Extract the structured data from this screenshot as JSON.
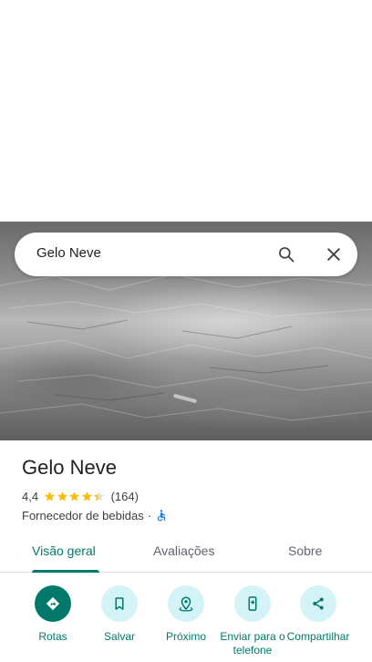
{
  "search": {
    "query": "Gelo Neve"
  },
  "place": {
    "title": "Gelo Neve",
    "rating": "4,4",
    "review_count": "(164)",
    "category": "Fornecedor de bebidas",
    "separator": "·",
    "stars_value": 4.4,
    "stars_max": 5,
    "star_color": "#fbbc04"
  },
  "tabs": [
    {
      "label": "Visão geral",
      "active": true
    },
    {
      "label": "Avaliações",
      "active": false
    },
    {
      "label": "Sobre",
      "active": false
    }
  ],
  "actions": [
    {
      "label": "Rotas",
      "icon": "directions-icon"
    },
    {
      "label": "Salvar",
      "icon": "bookmark-icon"
    },
    {
      "label": "Próximo",
      "icon": "nearby-icon"
    },
    {
      "label": "Enviar para o telefone",
      "icon": "send-to-phone-icon"
    },
    {
      "label": "Compartilhar",
      "icon": "share-icon"
    }
  ],
  "colors": {
    "accent": "#00796b",
    "action_bg": "#d4f3f6"
  }
}
